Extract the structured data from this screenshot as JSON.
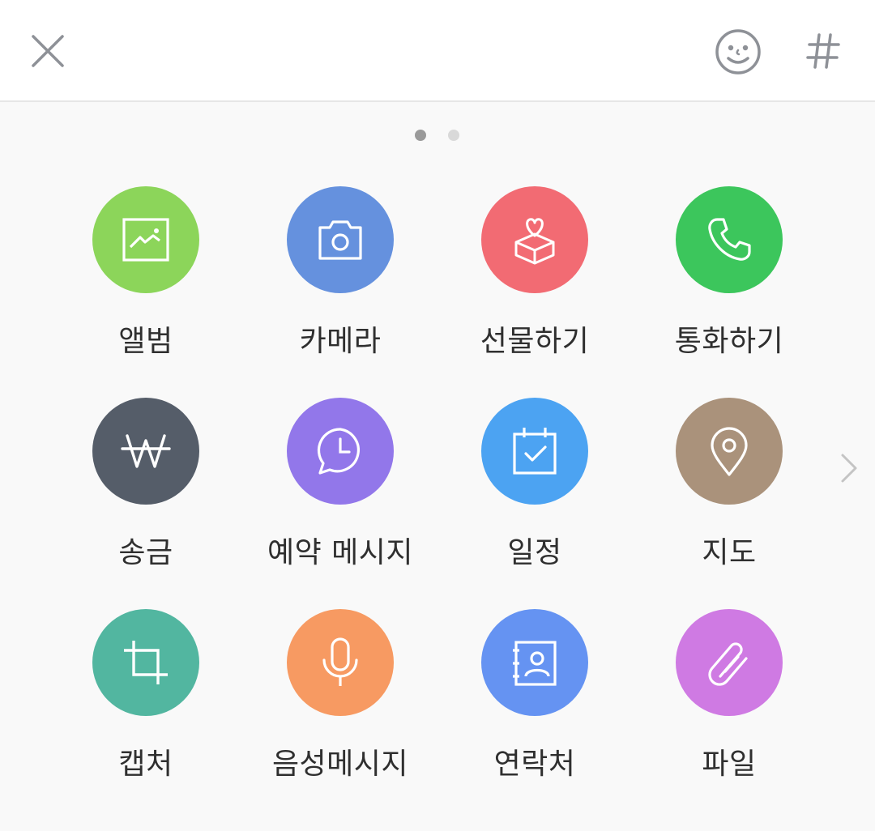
{
  "header": {
    "close_icon": "close-icon",
    "emoji_icon": "smiley-face-icon",
    "hash_icon": "hash-icon"
  },
  "pager": {
    "current_page": 1,
    "total_pages": 2
  },
  "menu_items": [
    {
      "label": "앨범",
      "icon": "image-icon",
      "color": "#8cd55a"
    },
    {
      "label": "카메라",
      "icon": "camera-icon",
      "color": "#6591de"
    },
    {
      "label": "선물하기",
      "icon": "gift-icon",
      "color": "#f26b73"
    },
    {
      "label": "통화하기",
      "icon": "phone-icon",
      "color": "#3cc65c"
    },
    {
      "label": "송금",
      "icon": "won-icon",
      "color": "#555d69"
    },
    {
      "label": "예약 메시지",
      "icon": "scheduled-message-icon",
      "color": "#9277ea"
    },
    {
      "label": "일정",
      "icon": "calendar-icon",
      "color": "#4ca3f2"
    },
    {
      "label": "지도",
      "icon": "map-pin-icon",
      "color": "#aa927b"
    },
    {
      "label": "캡처",
      "icon": "crop-icon",
      "color": "#52b6a0"
    },
    {
      "label": "음성메시지",
      "icon": "microphone-icon",
      "color": "#f79a62"
    },
    {
      "label": "연락처",
      "icon": "contact-card-icon",
      "color": "#6593f2"
    },
    {
      "label": "파일",
      "icon": "paperclip-icon",
      "color": "#cf7ae3"
    }
  ],
  "next_page_icon": "chevron-right-icon"
}
